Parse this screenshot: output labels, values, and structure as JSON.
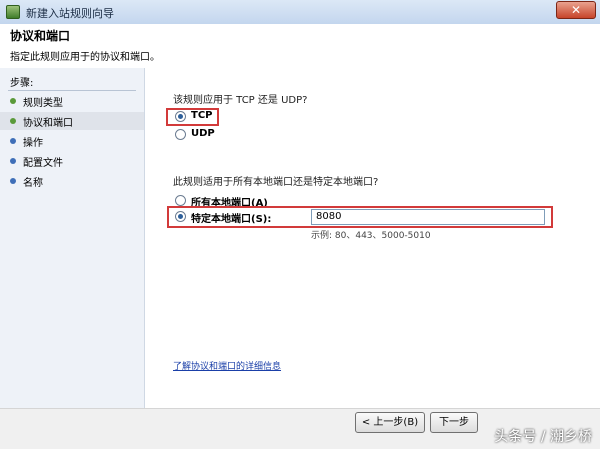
{
  "window": {
    "title": "新建入站规则向导"
  },
  "header": {
    "title": "协议和端口",
    "subtitle": "指定此规则应用于的协议和端口。"
  },
  "sidebar": {
    "steps_label": "步骤:",
    "items": [
      {
        "label": "规则类型",
        "dot_color": "#5a9a3a"
      },
      {
        "label": "协议和端口",
        "dot_color": "#5a9a3a"
      },
      {
        "label": "操作",
        "dot_color": "#3f6fb8"
      },
      {
        "label": "配置文件",
        "dot_color": "#3f6fb8"
      },
      {
        "label": "名称",
        "dot_color": "#3f6fb8"
      }
    ]
  },
  "protocol": {
    "question": "该规则应用于 TCP 还是 UDP?",
    "options": [
      {
        "label": "TCP",
        "selected": true
      },
      {
        "label": "UDP",
        "selected": false
      }
    ]
  },
  "ports": {
    "question": "此规则适用于所有本地端口还是特定本地端口?",
    "options": [
      {
        "label": "所有本地端口(A)",
        "selected": false
      },
      {
        "label": "特定本地端口(S):",
        "selected": true
      }
    ],
    "value": "8080",
    "example": "示例: 80、443、5000-5010"
  },
  "link": {
    "text": "了解协议和端口的详细信息"
  },
  "buttons": {
    "back": "< 上一步(B)",
    "next": "下一步"
  },
  "watermark": "头条号 / 潮乡桥",
  "colors": {
    "highlight": "#d23a3a"
  }
}
